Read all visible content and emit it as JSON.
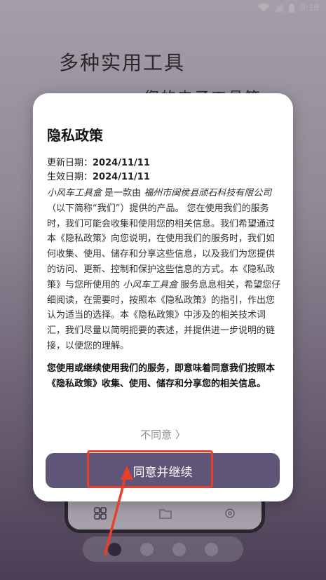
{
  "status_bar": {
    "time": "9:18"
  },
  "background": {
    "title": "多种实用工具",
    "subtitle_fragment": "您的电子工具箱"
  },
  "dialog": {
    "title": "隐私政策",
    "update_label": "更新日期：",
    "update_date": "2024/11/11",
    "effective_label": "生效日期：",
    "effective_date": "2024/11/11",
    "body": {
      "app_name": "小风车工具盒",
      "seg1": " 是一款由 ",
      "company": "福州市闽侯县顽石科技有限公司",
      "seg2": "（以下简称“我们”）提供的产品。 您在使用我们的服务时，我们可能会收集和使用您的相关信息。我们希望通过本《隐私政策》向您说明，在使用我们的服务时，我们如何收集、使用、储存和分享这些信息，以及我们为您提供的访问、更新、控制和保护这些信息的方式。本《隐私政策》与您所使用的 ",
      "app_name_2": "小风车工具盒",
      "seg3": " 服务息息相关，希望您仔细阅读，在需要时，按照本《隐私政策》的指引，作出您认为适当的选择。本《隐私政策》中涉及的相关技术词汇，我们尽量以简明扼要的表述，并提供进一步说明的链接，以便您的理解。"
    },
    "bold_notice": "您使用或继续使用我们的服务，即意味着同意我们按照本《隐私政策》收集、使用、储存和分享您的相关信息。",
    "disagree_label": "不同意 〉",
    "agree_label": "同意并继续"
  },
  "pager": {
    "count": 4,
    "active_index": 0
  },
  "colors": {
    "primary_button": "#5f5578",
    "highlight": "#e6402b"
  }
}
